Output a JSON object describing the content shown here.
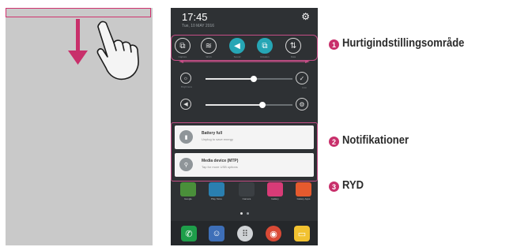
{
  "status_bar": {
    "time": "17:45",
    "date": "Tue, 10 MAY 2016"
  },
  "quick_settings": {
    "items": [
      {
        "icon": "screen-capture-icon",
        "label": "Capture",
        "on": false,
        "glyph": "⧉"
      },
      {
        "icon": "wifi-icon",
        "label": "Wi-Fi",
        "on": false,
        "glyph": "≋"
      },
      {
        "icon": "sound-icon",
        "label": "Sound",
        "on": true,
        "glyph": "◀"
      },
      {
        "icon": "rotation-icon",
        "label": "Rotation",
        "on": true,
        "glyph": "⧉"
      },
      {
        "icon": "data-icon",
        "label": "Data",
        "on": false,
        "glyph": "⇅"
      }
    ]
  },
  "sliders": [
    {
      "icon": "brightness-icon",
      "label": "Brightness",
      "level": 0.55,
      "right_icon": "check-icon",
      "right_label": "Auto",
      "right_glyph": "✓"
    },
    {
      "icon": "volume-icon",
      "label": "",
      "level": 0.65,
      "right_icon": "settings-icon",
      "right_label": "",
      "right_glyph": "⚙"
    }
  ],
  "notifications": [
    {
      "title": "Battery full",
      "subtitle": "Unplug to save energy",
      "icon": "battery-icon",
      "glyph": "▮"
    },
    {
      "title": "Media device (MTP)",
      "subtitle": "Tap for more USB options",
      "icon": "usb-icon",
      "glyph": "⚲"
    }
  ],
  "apps": [
    {
      "label": "Google",
      "color": "#4a8f3a"
    },
    {
      "label": "Play Store",
      "color": "#2a7fb0"
    },
    {
      "label": "Camera",
      "color": "#3b3f43"
    },
    {
      "label": "Gallery",
      "color": "#d83b77"
    },
    {
      "label": "Galaxy Apps",
      "color": "#e55a2e"
    }
  ],
  "dock": [
    {
      "icon": "phone-icon",
      "color": "#1e9e4a",
      "glyph": "✆"
    },
    {
      "icon": "contacts-icon",
      "color": "#3e6fb8",
      "glyph": "☺"
    },
    {
      "icon": "apps-icon",
      "color": "#d0d3d6",
      "glyph": "⠿"
    },
    {
      "icon": "chrome-icon",
      "color": "#d94a36",
      "glyph": "◉"
    },
    {
      "icon": "messages-icon",
      "color": "#f2c230",
      "glyph": "▭"
    }
  ],
  "callouts": [
    {
      "number": "1",
      "text": "Hurtigindstillingsområde"
    },
    {
      "number": "2",
      "text": "Notifikationer"
    },
    {
      "number": "3",
      "text": "RYD"
    }
  ],
  "colors": {
    "accent": "#c8306b",
    "toggle_on": "#26a6b5",
    "frame": "#c44e86"
  }
}
